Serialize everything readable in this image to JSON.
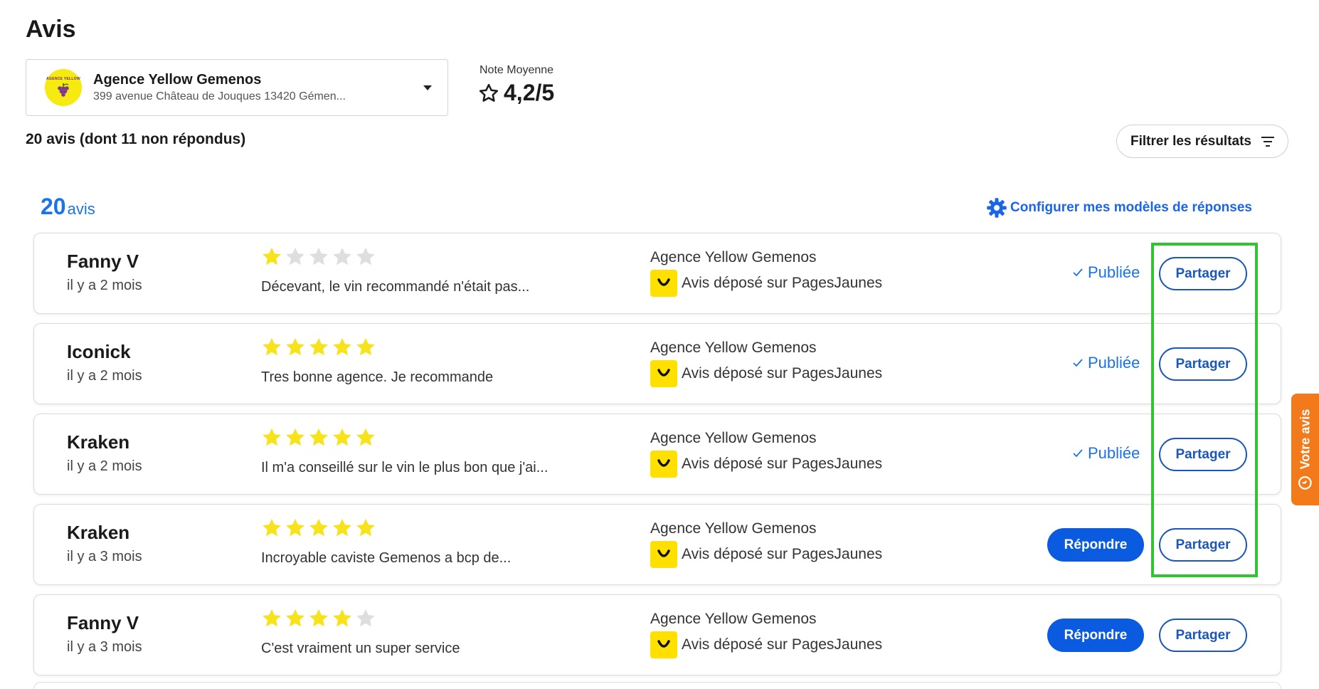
{
  "page": {
    "title": "Avis"
  },
  "agency": {
    "name": "Agence Yellow Gemenos",
    "address": "399 avenue Château de Jouques 13420 Gémen...",
    "logo_text": "AGENCE YELLOW"
  },
  "rating": {
    "label": "Note Moyenne",
    "value": "4,2/5"
  },
  "summary": "20 avis (dont 11 non répondus)",
  "filter": {
    "label": "Filtrer les résultats"
  },
  "count": {
    "number": "20",
    "label": "avis"
  },
  "config_link": "Configurer mes modèles de réponses",
  "feedback_tab": "Votre avis",
  "colors": {
    "accent": "#1a73e8",
    "primary_button": "#0a5be0",
    "star": "#f7e31b",
    "star_empty": "#dedede",
    "highlight": "#2ec52e",
    "feedback": "#f27a1a"
  },
  "reviews": [
    {
      "author": "Fanny V",
      "date": "il y a 2 mois",
      "rating": 1,
      "comment": "Décevant, le vin recommandé n'était pas...",
      "shop": "Agence Yellow Gemenos",
      "source": "Avis déposé sur PagesJaunes",
      "status": "Publiée",
      "share_label": "Partager"
    },
    {
      "author": "Iconick",
      "date": "il y a 2 mois",
      "rating": 5,
      "comment": "Tres bonne agence. Je recommande",
      "shop": "Agence Yellow Gemenos",
      "source": "Avis déposé sur PagesJaunes",
      "status": "Publiée",
      "share_label": "Partager"
    },
    {
      "author": "Kraken",
      "date": "il y a 2 mois",
      "rating": 5,
      "comment": "Il m'a conseillé sur le vin le plus bon que j'ai...",
      "shop": "Agence Yellow Gemenos",
      "source": "Avis déposé sur PagesJaunes",
      "status": "Publiée",
      "share_label": "Partager"
    },
    {
      "author": "Kraken",
      "date": "il y a 3 mois",
      "rating": 5,
      "comment": "Incroyable caviste Gemenos a bcp de...",
      "shop": "Agence Yellow Gemenos",
      "source": "Avis déposé sur PagesJaunes",
      "reply_label": "Répondre",
      "share_label": "Partager"
    },
    {
      "author": "Fanny V",
      "date": "il y a 3 mois",
      "rating": 4,
      "comment": "C'est vraiment un super service",
      "shop": "Agence Yellow Gemenos",
      "source": "Avis déposé sur PagesJaunes",
      "reply_label": "Répondre",
      "share_label": "Partager"
    }
  ]
}
